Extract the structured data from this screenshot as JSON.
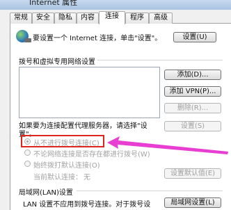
{
  "window": {
    "title": "Internet 属性"
  },
  "tabs": [
    "常规",
    "安全",
    "隐私",
    "内容",
    "连接",
    "程序",
    "高级"
  ],
  "setup": {
    "text": "要设置一个 Internet 连接，单击\"设置\"。",
    "button": "设置(U)"
  },
  "dialup": {
    "heading": "拨号和虚拟专用网络设置",
    "add_button": "添加(D)...",
    "add_vpn_button": "添加 VPN(P)...",
    "delete_button": "删除(R)...",
    "proxy_text_line1": "如果要为连接配置代理服务器，请选择\"设",
    "proxy_text_line2": "置\"。",
    "settings_button": "设置(S)",
    "options": [
      {
        "label": "从不进行拨号连接(C)",
        "checked": true
      },
      {
        "label": "不论网络连接是否存在都进行拨号(W)",
        "checked": false
      },
      {
        "label": "始终拨打默认连接(O)",
        "checked": false
      }
    ],
    "current_default_label": "当前默认连接：",
    "current_default_value": "无",
    "set_default_button": "设置默认值(E)"
  },
  "lan": {
    "heading": "局域网(LAN)设置",
    "text": "LAN 设置不应用到拨号连接。对于拨号设",
    "button": "局域网设置(L)"
  },
  "annotation": {
    "highlight_color": "#e0261c",
    "arrow_color": "#e83fd2"
  }
}
